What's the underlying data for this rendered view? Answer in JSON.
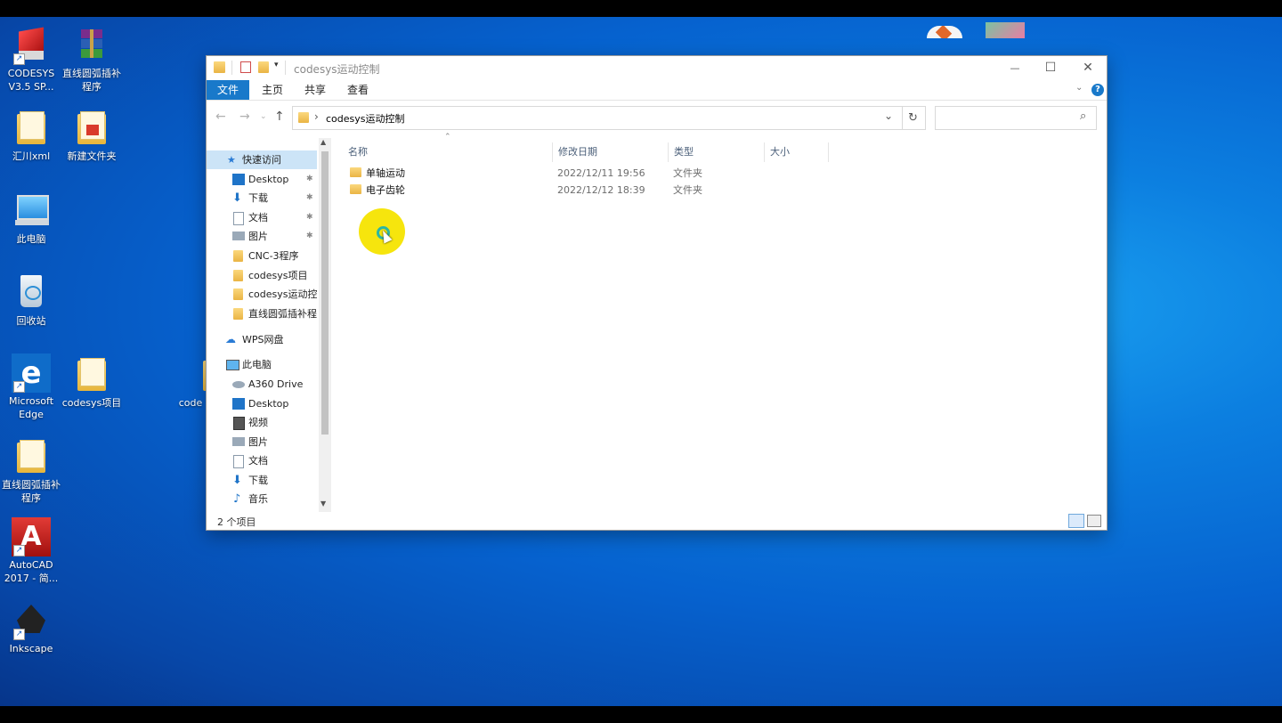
{
  "desktop": {
    "icons": [
      {
        "label": "CODESYS V3.5 SP...",
        "icon": "codesys-icon"
      },
      {
        "label": "直线圆弧插补程序",
        "icon": "winrar-archive-icon"
      },
      {
        "label": "汇川xml",
        "icon": "folder-icon"
      },
      {
        "label": "新建文件夹",
        "icon": "folder-icon"
      },
      {
        "label": "此电脑",
        "icon": "computer-icon"
      },
      {
        "label": "回收站",
        "icon": "recycle-bin-icon"
      },
      {
        "label": "Microsoft Edge",
        "icon": "edge-icon"
      },
      {
        "label": "codesys项目",
        "icon": "folder-icon"
      },
      {
        "label": "code",
        "icon": "folder-icon"
      },
      {
        "label": "直线圆弧插补程序",
        "icon": "folder-icon"
      },
      {
        "label": "AutoCAD 2017 - 简...",
        "icon": "autocad-icon"
      },
      {
        "label": "Inkscape",
        "icon": "inkscape-icon"
      }
    ]
  },
  "window": {
    "title": "codesys运动控制",
    "controls": {
      "minimize": "—",
      "maximize": "☐",
      "close": "✕"
    },
    "ribbon_tabs": [
      "文件",
      "主页",
      "共享",
      "查看"
    ],
    "address": {
      "separator": "›",
      "path": "codesys运动控制"
    },
    "search": {
      "placeholder": ""
    },
    "nav": {
      "quick_access": "快速访问",
      "quick_items": [
        {
          "label": "Desktop",
          "icon": "desktop-icon",
          "pinned": true
        },
        {
          "label": "下载",
          "icon": "download-icon",
          "pinned": true
        },
        {
          "label": "文档",
          "icon": "document-icon",
          "pinned": true
        },
        {
          "label": "图片",
          "icon": "picture-icon",
          "pinned": true
        },
        {
          "label": "CNC-3程序",
          "icon": "folder-icon",
          "pinned": false
        },
        {
          "label": "codesys项目",
          "icon": "folder-icon",
          "pinned": false
        },
        {
          "label": "codesys运动控制",
          "icon": "folder-icon",
          "pinned": false
        },
        {
          "label": "直线圆弧插补程序",
          "icon": "folder-icon",
          "pinned": false
        }
      ],
      "wps": "WPS网盘",
      "this_pc": "此电脑",
      "pc_items": [
        {
          "label": "A360 Drive",
          "icon": "drive-icon"
        },
        {
          "label": "Desktop",
          "icon": "desktop-icon"
        },
        {
          "label": "视频",
          "icon": "video-icon"
        },
        {
          "label": "图片",
          "icon": "picture-icon"
        },
        {
          "label": "文档",
          "icon": "document-icon"
        },
        {
          "label": "下载",
          "icon": "download-icon"
        },
        {
          "label": "音乐",
          "icon": "music-icon"
        }
      ]
    },
    "columns": {
      "name": "名称",
      "modified": "修改日期",
      "type": "类型",
      "size": "大小"
    },
    "files": [
      {
        "name": "单轴运动",
        "modified": "2022/12/11 19:56",
        "type": "文件夹"
      },
      {
        "name": "电子齿轮",
        "modified": "2022/12/12 18:39",
        "type": "文件夹"
      }
    ],
    "status": "2 个项目"
  },
  "colors": {
    "accent": "#1979ca",
    "desktop": "#0a6fd8",
    "cursor_highlight": "#f5e400"
  }
}
